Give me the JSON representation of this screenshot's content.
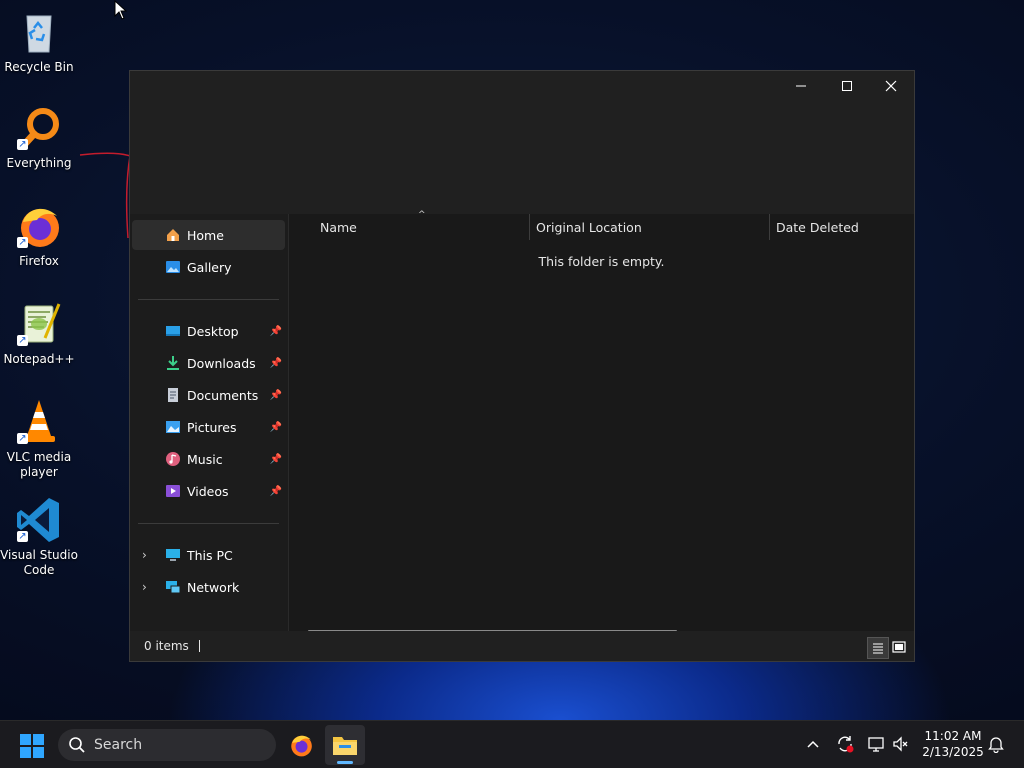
{
  "desktop": {
    "icons": [
      {
        "label": "Recycle Bin"
      },
      {
        "label": "Everything"
      },
      {
        "label": "Firefox"
      },
      {
        "label": "Notepad++"
      },
      {
        "label": "VLC media player"
      },
      {
        "label": "Visual Studio Code"
      }
    ]
  },
  "window": {
    "controls": {
      "minimize": "–",
      "maximize": "☐",
      "close": "✕"
    },
    "nav": {
      "home": "Home",
      "gallery": "Gallery",
      "pinned": [
        "Desktop",
        "Downloads",
        "Documents",
        "Pictures",
        "Music",
        "Videos"
      ],
      "this_pc": "This PC",
      "network": "Network"
    },
    "columns": {
      "name": "Name",
      "original_location": "Original Location",
      "date_deleted": "Date Deleted"
    },
    "empty_message": "This folder is empty.",
    "status": {
      "items": "0 items"
    }
  },
  "taskbar": {
    "search_label": "Search",
    "clock": {
      "time": "11:02 AM",
      "date": "2/13/2025"
    }
  },
  "colors": {
    "accent": "#2fa6ff",
    "window_bg": "#202020",
    "content_bg": "#191919",
    "folder": "#f4c542"
  }
}
